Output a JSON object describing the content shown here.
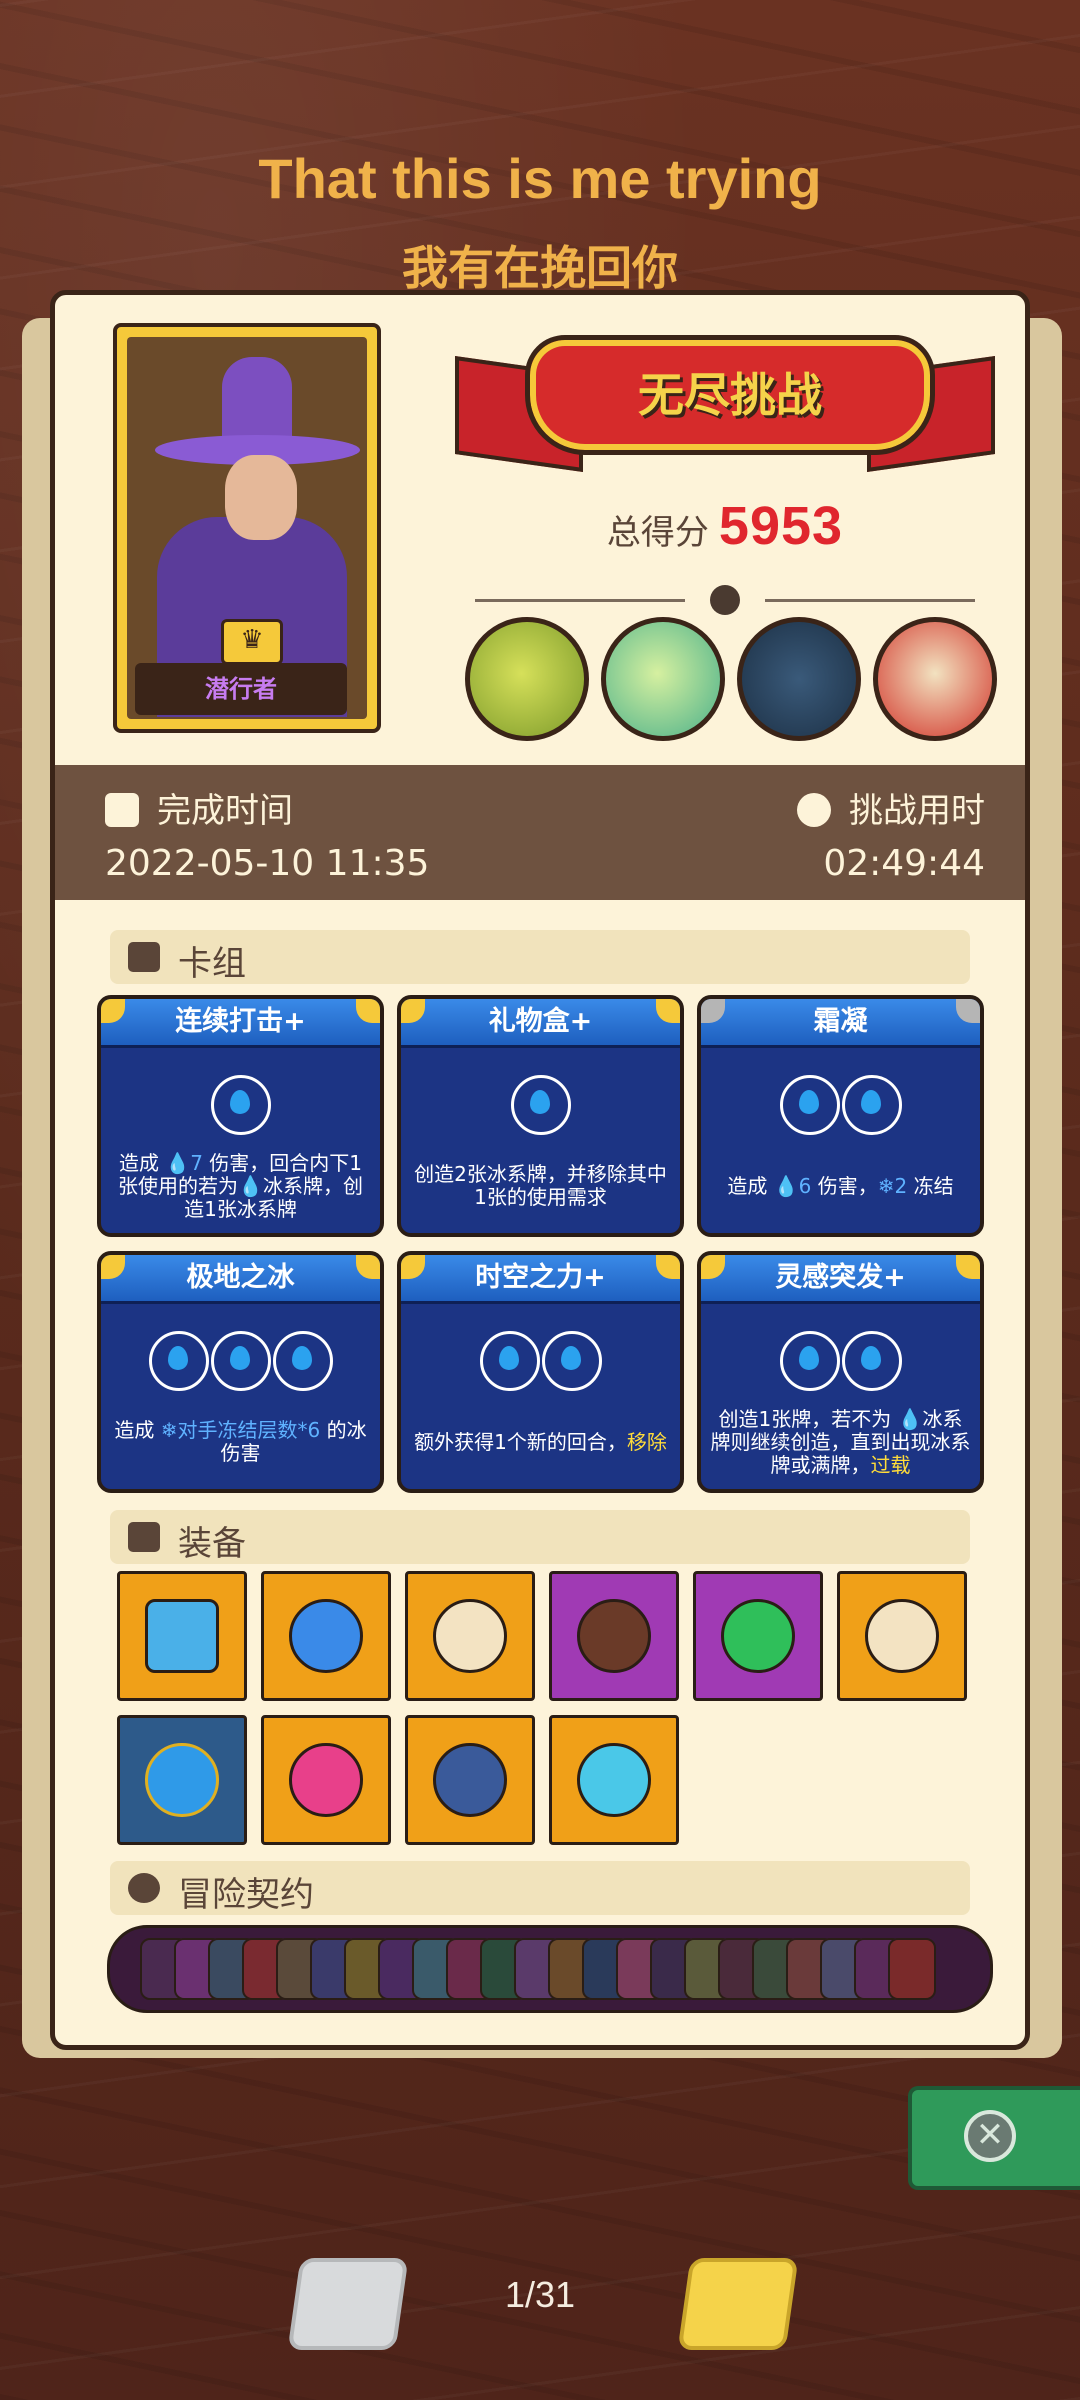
{
  "header": {
    "title_en": "That this is me trying",
    "title_cn": "我有在挽回你"
  },
  "hero": {
    "name": "潜行者",
    "crown_icon": "crown-icon"
  },
  "challenge": {
    "banner": "无尽挑战",
    "score_label": "总得分",
    "score_value": "5953",
    "bosses": [
      "boss-skeleton-lizard",
      "boss-sea-dragon",
      "boss-knight",
      "boss-fire-lord"
    ]
  },
  "stats": {
    "finish_time_label": "完成时间",
    "finish_time_value": "2022-05-10 11:35",
    "elapsed_label": "挑战用时",
    "elapsed_value": "02:49:44"
  },
  "deck": {
    "section_title": "卡组",
    "cards": [
      {
        "name": "连续打击+",
        "cost": 1,
        "desc_parts": [
          "造成 ",
          "7",
          " 伤害，回合内下1张使用的若为",
          "冰系牌，创造1张冰系牌"
        ]
      },
      {
        "name": "礼物盒+",
        "cost": 1,
        "desc": "创造2张冰系牌，并移除其中1张的使用需求"
      },
      {
        "name": "霜凝",
        "cost": 2,
        "desc_parts": [
          "造成 ",
          "6",
          " 伤害，",
          "2",
          " 冻结"
        ]
      },
      {
        "name": "极地之冰",
        "cost": 3,
        "desc_parts": [
          "造成 ",
          "对手冻结层数*6",
          " 的冰伤害"
        ]
      },
      {
        "name": "时空之力+",
        "cost": 2,
        "desc_parts": [
          "额外获得1个新的回合，",
          "移除"
        ]
      },
      {
        "name": "灵感突发+",
        "cost": 2,
        "desc_parts": [
          "创造1张牌，若不为 ",
          "冰系牌则继续创造，直到出现冰系牌或满牌，",
          "过载"
        ]
      }
    ]
  },
  "equipment": {
    "section_title": "装备",
    "items": [
      {
        "icon": "potion-bottle-icon",
        "rarity": "orange"
      },
      {
        "icon": "mushroom-icon",
        "rarity": "orange"
      },
      {
        "icon": "shield-disc-icon",
        "rarity": "orange"
      },
      {
        "icon": "button-icon",
        "rarity": "purple"
      },
      {
        "icon": "clover-icon",
        "rarity": "purple"
      },
      {
        "icon": "spiked-ball-icon",
        "rarity": "orange"
      },
      {
        "icon": "water-gem-icon",
        "rarity": "blue"
      },
      {
        "icon": "fire-orb-icon",
        "rarity": "orange"
      },
      {
        "icon": "hexagram-icon",
        "rarity": "orange"
      },
      {
        "icon": "ice-crest-icon",
        "rarity": "orange"
      }
    ]
  },
  "contracts": {
    "section_title": "冒险契约"
  },
  "pager": {
    "page": "1/31"
  },
  "colors": {
    "accent_gold": "#f0b24a",
    "score_red": "#e0262e",
    "card_blue": "#1c3484"
  }
}
